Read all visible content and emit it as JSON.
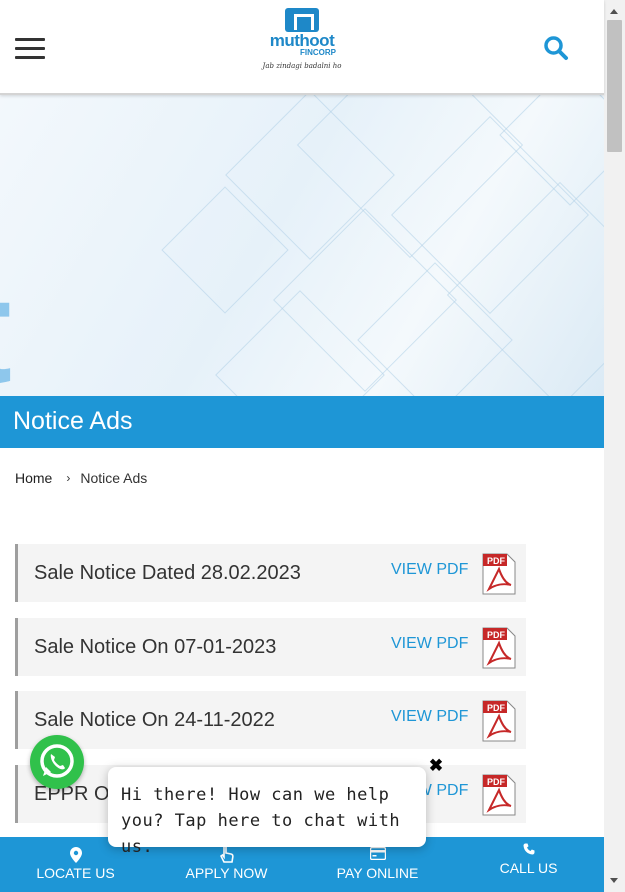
{
  "header": {
    "logo_brand": "muthoot",
    "logo_sub": "FINCORP",
    "logo_tagline": "Jab zindagi badalni ho",
    "menu_icon": "hamburger-icon",
    "search_icon": "search-icon"
  },
  "page": {
    "title": "Notice Ads"
  },
  "breadcrumb": {
    "home": "Home",
    "current": "Notice Ads"
  },
  "notices": [
    {
      "title": "Sale Notice Dated 28.02.2023",
      "link": "VIEW PDF"
    },
    {
      "title": "Sale Notice On 07-01-2023",
      "link": "VIEW PDF"
    },
    {
      "title": "Sale Notice On 24-11-2022",
      "link": "VIEW PDF"
    },
    {
      "title": "EPPR O",
      "link": "VIEW PDF"
    }
  ],
  "pdf_badge": "PDF",
  "chat": {
    "message": "Hi there! How can we help you? Tap here to chat with us.",
    "close_symbol": "✖"
  },
  "bottom_nav": [
    {
      "label": "LOCATE US",
      "icon": "map-pin-icon"
    },
    {
      "label": "APPLY NOW",
      "icon": "hand-pointer-icon"
    },
    {
      "label": "PAY ONLINE",
      "icon": "credit-card-icon"
    },
    {
      "label": "CALL US",
      "icon": "phone-icon"
    }
  ],
  "colors": {
    "brand_blue": "#1e96d6",
    "whatsapp_green": "#30c14b",
    "pdf_red": "#c62828"
  }
}
